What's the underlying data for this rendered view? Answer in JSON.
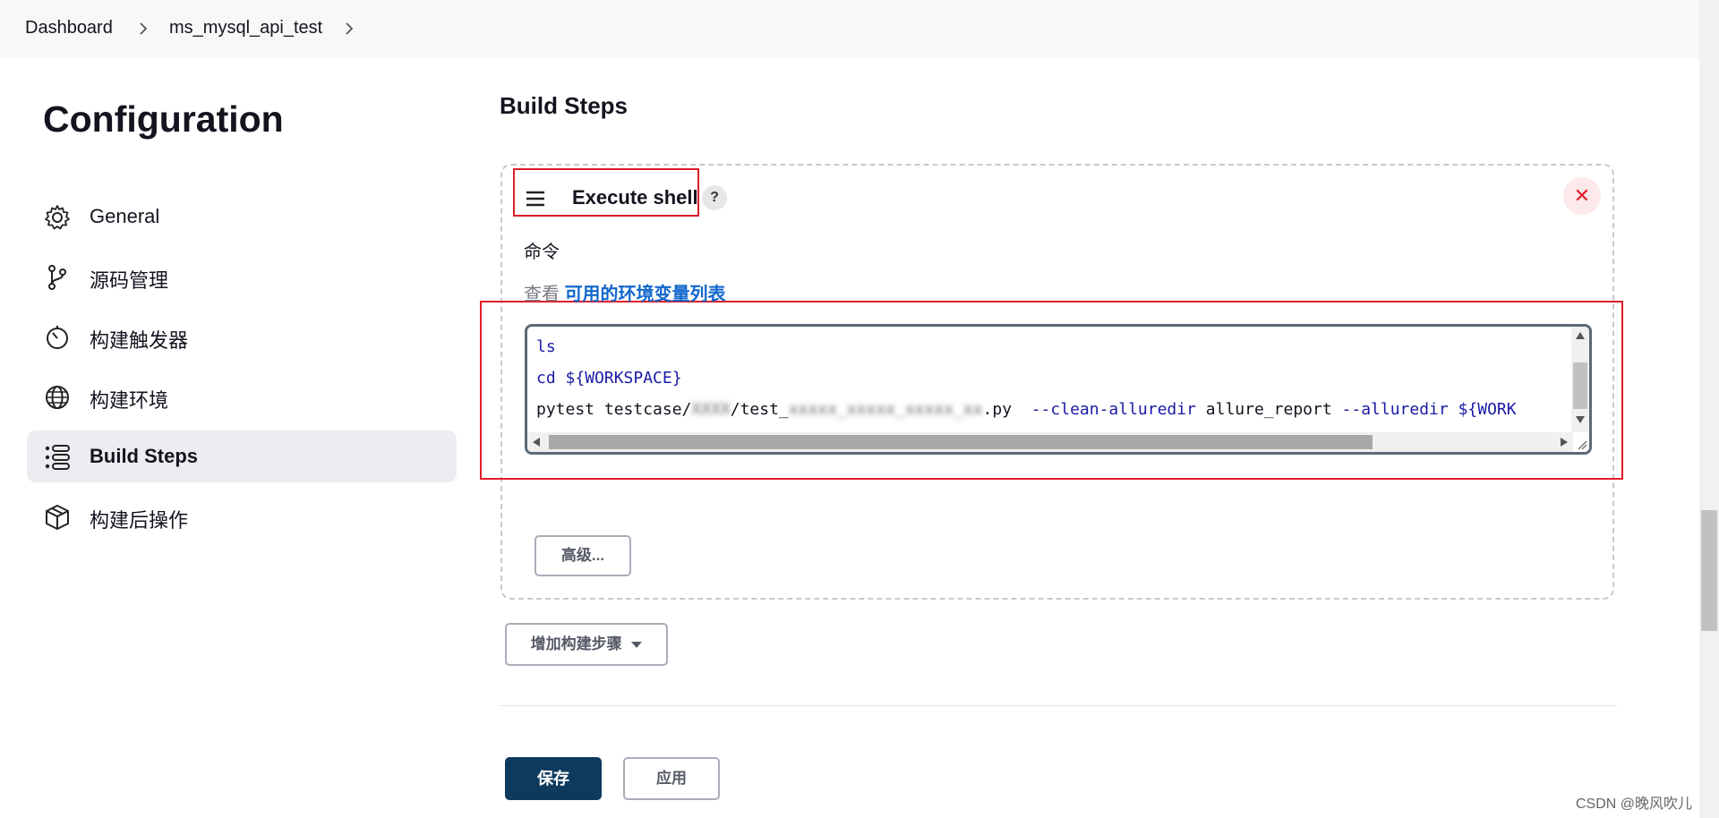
{
  "breadcrumb": {
    "items": [
      "Dashboard",
      "ms_mysql_api_test"
    ]
  },
  "page_title": "Configuration",
  "sidebar": {
    "items": [
      {
        "label": "General",
        "icon": "gear-icon"
      },
      {
        "label": "源码管理",
        "icon": "branch-icon"
      },
      {
        "label": "构建触发器",
        "icon": "timer-icon"
      },
      {
        "label": "构建环境",
        "icon": "globe-icon"
      },
      {
        "label": "Build Steps",
        "icon": "list-icon",
        "active": true
      },
      {
        "label": "构建后操作",
        "icon": "package-icon"
      }
    ]
  },
  "main": {
    "section_title": "Build Steps",
    "step": {
      "title": "Execute shell",
      "help": "?",
      "close": "✕",
      "command_label": "命令",
      "env_prefix": "查看",
      "env_link": "可用的环境变量列表",
      "code": {
        "line1": "ls",
        "line2_cmd": "cd ",
        "line2_var": "${WORKSPACE}",
        "line3_a": "pytest testcase/",
        "line3_blur1": "XXXX",
        "line3_b": "/test_",
        "line3_blur2": "xxxxx_xxxxx_xxxxx_xx",
        "line3_c": ".py  ",
        "line3_opt1": "--clean-alluredir",
        "line3_d": " allure_report ",
        "line3_opt2": "--alluredir",
        "line3_var": " ${WORK"
      },
      "advanced_button": "高级..."
    },
    "add_step_button": "增加构建步骤",
    "save_button": "保存",
    "apply_button": "应用"
  },
  "watermark": "CSDN @晚风吹儿"
}
